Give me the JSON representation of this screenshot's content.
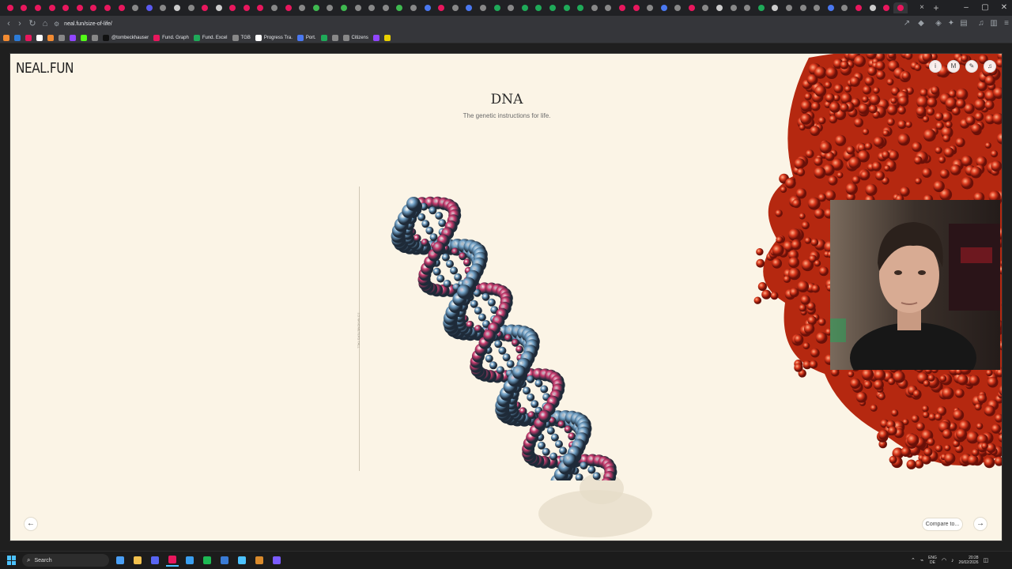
{
  "browser": {
    "url": "neal.fun/size-of-life/",
    "tab_favicon_colors": [
      "#e8175d",
      "#e8175d",
      "#e8175d",
      "#e8175d",
      "#e8175d",
      "#e8175d",
      "#e8175d",
      "#e8175d",
      "#e8175d",
      "#888888",
      "#5a5af0",
      "#888888",
      "#cccccc",
      "#888888",
      "#e8175d",
      "#cccccc",
      "#e8175d",
      "#e8175d",
      "#e8175d",
      "#888888",
      "#e8175d",
      "#888888",
      "#3fb950",
      "#888888",
      "#3fb950",
      "#888888",
      "#888888",
      "#888888",
      "#3fb950",
      "#888888",
      "#4a78f0",
      "#e8175d",
      "#888888",
      "#4a78f0",
      "#888888",
      "#1faa59",
      "#888888",
      "#1faa59",
      "#1faa59",
      "#1faa59",
      "#1faa59",
      "#1faa59",
      "#888888",
      "#888888",
      "#e8175d",
      "#e8175d",
      "#888888",
      "#4a78f0",
      "#888888",
      "#e8175d",
      "#888888",
      "#cccccc",
      "#888888",
      "#888888",
      "#1faa59",
      "#cccccc",
      "#888888",
      "#888888",
      "#888888",
      "#4a78f0",
      "#888888",
      "#e8175d",
      "#cccccc",
      "#e8175d",
      "#e8175d"
    ],
    "tab_close": "×",
    "tab_new": "+",
    "window_minimize": "–",
    "window_maximize": "▢",
    "window_close": "✕",
    "bookmarks": [
      {
        "label": "",
        "color": "#f28b32"
      },
      {
        "label": "",
        "color": "#2b7bd8"
      },
      {
        "label": "",
        "color": "#e8175d"
      },
      {
        "label": "",
        "color": "#ffffff"
      },
      {
        "label": "",
        "color": "#f28b32"
      },
      {
        "label": "",
        "color": "#888888"
      },
      {
        "label": "",
        "color": "#9146ff"
      },
      {
        "label": "",
        "color": "#53fc18"
      },
      {
        "label": "",
        "color": "#888888"
      },
      {
        "label": "@tombeckhauser",
        "color": "#111111"
      },
      {
        "label": "Fund. Graph",
        "color": "#e8175d"
      },
      {
        "label": "Fund. Excel",
        "color": "#1faa59"
      },
      {
        "label": "TGB",
        "color": "#888888"
      },
      {
        "label": "Progress Tra.",
        "color": "#ffffff"
      },
      {
        "label": "Port.",
        "color": "#4a78f0"
      },
      {
        "label": "",
        "color": "#1faa59"
      },
      {
        "label": "",
        "color": "#888888"
      },
      {
        "label": "Citizens",
        "color": "#888888"
      },
      {
        "label": "",
        "color": "#9146ff"
      },
      {
        "label": "",
        "color": "#e8d000"
      }
    ]
  },
  "page": {
    "logo": "NEAL.FUN",
    "title": "DNA",
    "subtitle": "The genetic instructions for life.",
    "scale_label": "3.5 NANOMETERS TALL",
    "compare_label": "Compare to...",
    "prev_icon": "←",
    "next_icon": "→",
    "top_icons": [
      "i",
      "M",
      "✎",
      "♫"
    ]
  },
  "colors": {
    "page_bg": "#fbf4e6",
    "dna_blue": "#6f9fc4",
    "dna_pink": "#c8396c",
    "protein_red": "#d9381c"
  },
  "taskbar": {
    "search_label": "Search",
    "app_colors": [
      "#4a9ff5",
      "#f2c14e",
      "#5865f2",
      "#e8175d",
      "#3a9ff0",
      "#1db954",
      "#3a7bd5",
      "#4cc2ff",
      "#d98a2b",
      "#7b5cff"
    ],
    "lang": "ENG\nDE",
    "time": "20:28",
    "date": "26/02/2026"
  }
}
